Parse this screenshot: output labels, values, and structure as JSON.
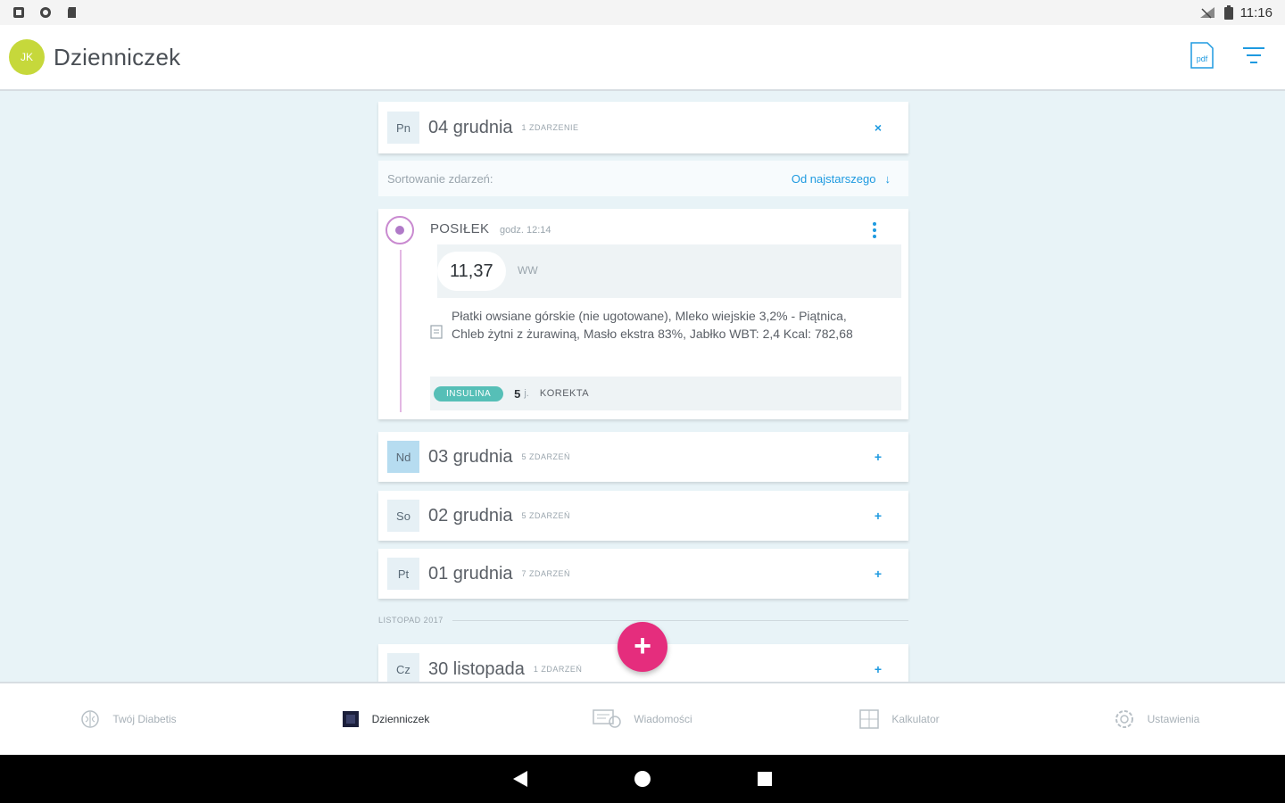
{
  "status_bar": {
    "time": "11:16"
  },
  "app_bar": {
    "avatar_initials": "JK",
    "title": "Dzienniczek",
    "pdf_label": "pdf"
  },
  "days": [
    {
      "weekday": "Pn",
      "date": "04 grudnia",
      "count": "1 ZDARZENIE",
      "toggle": "×",
      "active": false
    },
    {
      "weekday": "Nd",
      "date": "03 grudnia",
      "count": "5 ZDARZEŃ",
      "toggle": "+",
      "active": true
    },
    {
      "weekday": "So",
      "date": "02 grudnia",
      "count": "5 ZDARZEŃ",
      "toggle": "+",
      "active": false
    },
    {
      "weekday": "Pt",
      "date": "01 grudnia",
      "count": "7 ZDARZEŃ",
      "toggle": "+",
      "active": false
    },
    {
      "weekday": "Cz",
      "date": "30 listopada",
      "count": "1 ZDARZEŃ",
      "toggle": "+",
      "active": false
    }
  ],
  "sort": {
    "label": "Sortowanie zdarzeń:",
    "value": "Od najstarszego",
    "arrow": "↓"
  },
  "event": {
    "type": "POSIŁEK",
    "time": "godz. 12:14",
    "ww_value": "11,37",
    "ww_unit": "WW",
    "description": "Płatki owsiane górskie (nie ugotowane), Mleko wiejskie 3,2% - Piątnica, Chleb żytni z żurawiną, Masło ekstra 83%, Jabłko WBT: 2,4 Kcal: 782,68",
    "insulin_badge": "INSULINA",
    "insulin_value": "5",
    "insulin_unit": "j.",
    "insulin_type": "KOREKTA"
  },
  "month_separator": "LISTOPAD 2017",
  "fab_label": "+",
  "bottom_nav": [
    {
      "label": "Twój Diabetis",
      "icon": "brain-icon",
      "active": false
    },
    {
      "label": "Dzienniczek",
      "icon": "journal-icon",
      "active": true
    },
    {
      "label": "Wiadomości",
      "icon": "messages-icon",
      "active": false
    },
    {
      "label": "Kalkulator",
      "icon": "calculator-icon",
      "active": false
    },
    {
      "label": "Ustawienia",
      "icon": "settings-icon",
      "active": false
    }
  ],
  "colors": {
    "accent": "#1e9ae0",
    "fab": "#e52d7d",
    "avatar": "#c6d83b",
    "insulin": "#56bfb7",
    "meal": "#b07ac8",
    "background": "#e8f3f7"
  }
}
